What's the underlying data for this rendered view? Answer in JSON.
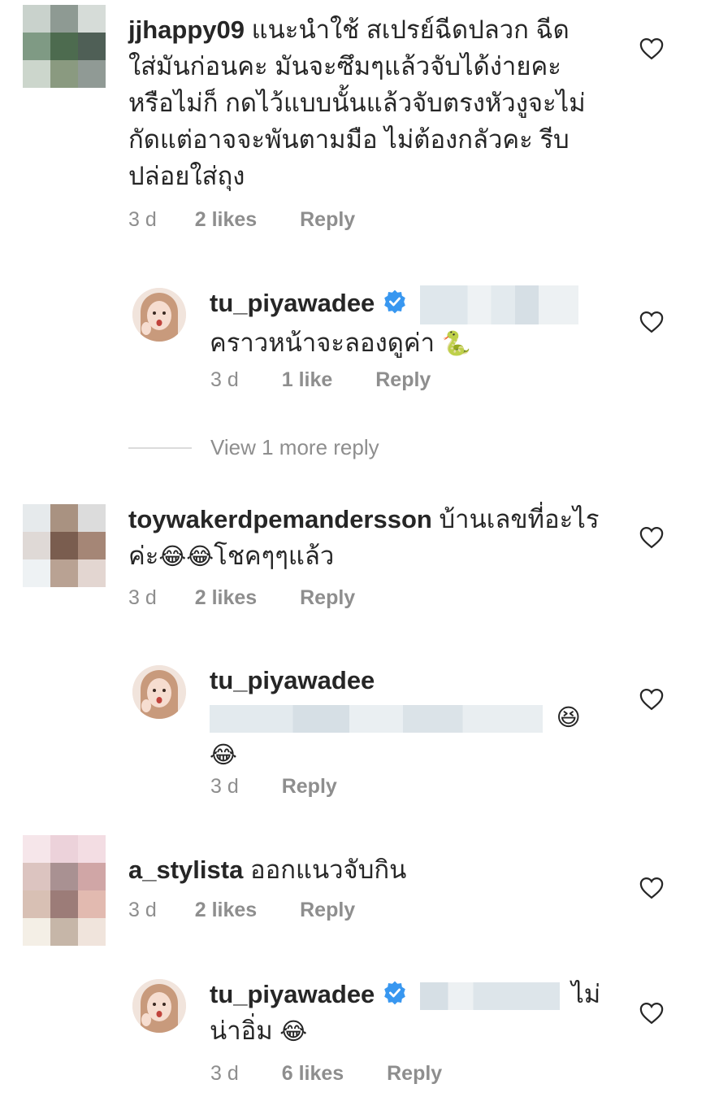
{
  "comments": [
    {
      "username": "jjhappy09",
      "text": "แนะนำใช้ สเปรย์ฉีดปลวก ฉีด",
      "text_lines": [
        "ใส่มันก่อนคะ มันจะซึมๆแล้วจับได้ง่ายคะ",
        "หรือไม่ก็ กดไว้แบบนั้นแล้วจับตรงหัวงูจะไม่",
        "กัดแต่อาจจะพันตามมือ ไม่ต้องกลัวคะ รีบ",
        "ปล่อยใส่ถุง"
      ],
      "time": "3 d",
      "likes": "2 likes",
      "reply": "Reply",
      "replies": [
        {
          "username": "tu_piyawadee",
          "verified": true,
          "text": "คราวหน้าจะลองดูค่า",
          "emoji": "🐍",
          "time": "3 d",
          "likes": "1 like",
          "reply": "Reply"
        }
      ],
      "view_more": "View 1 more reply"
    },
    {
      "username": "toywakerdpemandersson",
      "text": "บ้านเลขที่อะไร",
      "text_line2_prefix": "ค่ะ",
      "text_line2_emoji": "😂😂",
      "text_line2_suffix": "โชคๆๆแล้ว",
      "time": "3 d",
      "likes": "2 likes",
      "reply": "Reply",
      "replies": [
        {
          "username": "tu_piyawadee",
          "verified": false,
          "emoji1": "😆",
          "emoji2": "😂",
          "time": "3 d",
          "reply": "Reply"
        }
      ]
    },
    {
      "username": "a_stylista",
      "text": "ออกแนวจับกิน",
      "time": "3 d",
      "likes": "2 likes",
      "reply": "Reply",
      "replies": [
        {
          "username": "tu_piyawadee",
          "verified": true,
          "text_end": "ไม่",
          "text_line2": "น่าอิ่ม",
          "emoji": "😂",
          "time": "3 d",
          "likes": "6 likes",
          "reply": "Reply"
        }
      ]
    }
  ],
  "icons": {
    "heart": "heart-outline-icon",
    "verified": "verified-badge-icon"
  },
  "colors": {
    "text": "#262626",
    "meta": "#8e8e8e",
    "verified": "#3897f0",
    "divider": "#dbdbdb"
  }
}
